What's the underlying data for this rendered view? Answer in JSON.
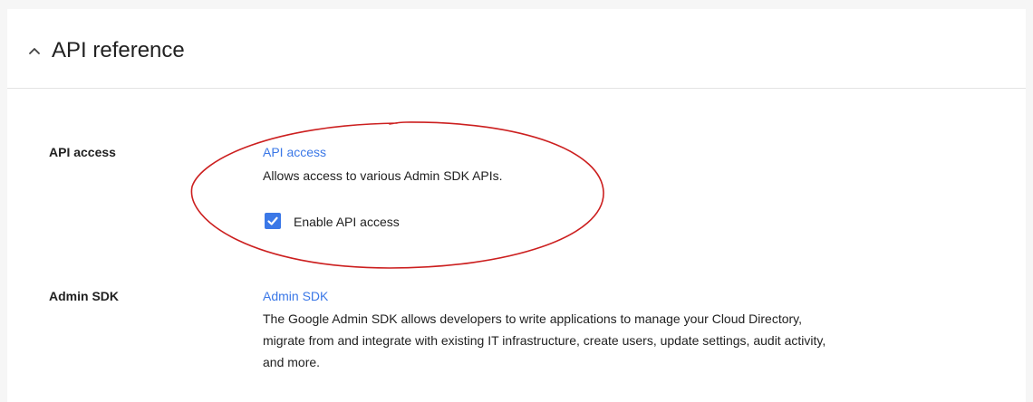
{
  "section": {
    "title": "API reference",
    "chevron_icon": "chevron-up-icon"
  },
  "api_access": {
    "row_label": "API access",
    "link_label": "API access",
    "description": "Allows access to various Admin SDK APIs.",
    "checkbox": {
      "label": "Enable API access",
      "checked": true
    }
  },
  "admin_sdk": {
    "row_label": "Admin SDK",
    "link_label": "Admin SDK",
    "description_lines": [
      "The Google Admin SDK allows developers to write applications to manage your Cloud Directory,",
      "migrate from and integrate with existing IT infrastructure, create users, update settings, audit activity,",
      "and more."
    ]
  },
  "colors": {
    "link": "#3b78e7",
    "checkbox": "#3b78e7",
    "annotation_ellipse": "#cc1f1f",
    "text": "#212121",
    "background": "#f6f6f6"
  }
}
